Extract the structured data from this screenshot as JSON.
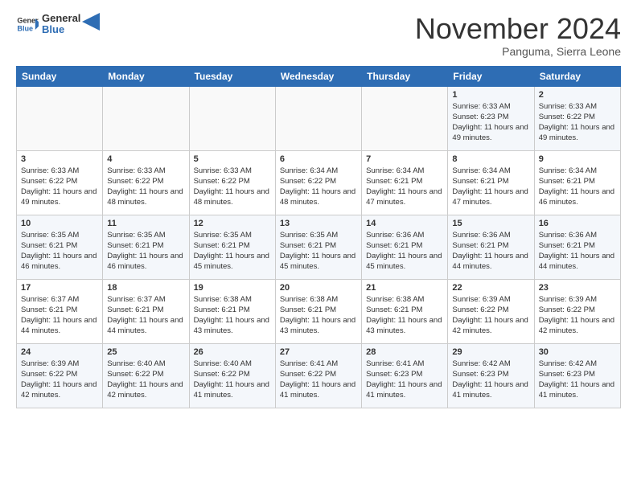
{
  "header": {
    "logo_line1": "General",
    "logo_line2": "Blue",
    "month": "November 2024",
    "location": "Panguma, Sierra Leone"
  },
  "weekdays": [
    "Sunday",
    "Monday",
    "Tuesday",
    "Wednesday",
    "Thursday",
    "Friday",
    "Saturday"
  ],
  "weeks": [
    [
      {
        "day": "",
        "info": ""
      },
      {
        "day": "",
        "info": ""
      },
      {
        "day": "",
        "info": ""
      },
      {
        "day": "",
        "info": ""
      },
      {
        "day": "",
        "info": ""
      },
      {
        "day": "1",
        "info": "Sunrise: 6:33 AM\nSunset: 6:23 PM\nDaylight: 11 hours and 49 minutes."
      },
      {
        "day": "2",
        "info": "Sunrise: 6:33 AM\nSunset: 6:22 PM\nDaylight: 11 hours and 49 minutes."
      }
    ],
    [
      {
        "day": "3",
        "info": "Sunrise: 6:33 AM\nSunset: 6:22 PM\nDaylight: 11 hours and 49 minutes."
      },
      {
        "day": "4",
        "info": "Sunrise: 6:33 AM\nSunset: 6:22 PM\nDaylight: 11 hours and 48 minutes."
      },
      {
        "day": "5",
        "info": "Sunrise: 6:33 AM\nSunset: 6:22 PM\nDaylight: 11 hours and 48 minutes."
      },
      {
        "day": "6",
        "info": "Sunrise: 6:34 AM\nSunset: 6:22 PM\nDaylight: 11 hours and 48 minutes."
      },
      {
        "day": "7",
        "info": "Sunrise: 6:34 AM\nSunset: 6:21 PM\nDaylight: 11 hours and 47 minutes."
      },
      {
        "day": "8",
        "info": "Sunrise: 6:34 AM\nSunset: 6:21 PM\nDaylight: 11 hours and 47 minutes."
      },
      {
        "day": "9",
        "info": "Sunrise: 6:34 AM\nSunset: 6:21 PM\nDaylight: 11 hours and 46 minutes."
      }
    ],
    [
      {
        "day": "10",
        "info": "Sunrise: 6:35 AM\nSunset: 6:21 PM\nDaylight: 11 hours and 46 minutes."
      },
      {
        "day": "11",
        "info": "Sunrise: 6:35 AM\nSunset: 6:21 PM\nDaylight: 11 hours and 46 minutes."
      },
      {
        "day": "12",
        "info": "Sunrise: 6:35 AM\nSunset: 6:21 PM\nDaylight: 11 hours and 45 minutes."
      },
      {
        "day": "13",
        "info": "Sunrise: 6:35 AM\nSunset: 6:21 PM\nDaylight: 11 hours and 45 minutes."
      },
      {
        "day": "14",
        "info": "Sunrise: 6:36 AM\nSunset: 6:21 PM\nDaylight: 11 hours and 45 minutes."
      },
      {
        "day": "15",
        "info": "Sunrise: 6:36 AM\nSunset: 6:21 PM\nDaylight: 11 hours and 44 minutes."
      },
      {
        "day": "16",
        "info": "Sunrise: 6:36 AM\nSunset: 6:21 PM\nDaylight: 11 hours and 44 minutes."
      }
    ],
    [
      {
        "day": "17",
        "info": "Sunrise: 6:37 AM\nSunset: 6:21 PM\nDaylight: 11 hours and 44 minutes."
      },
      {
        "day": "18",
        "info": "Sunrise: 6:37 AM\nSunset: 6:21 PM\nDaylight: 11 hours and 44 minutes."
      },
      {
        "day": "19",
        "info": "Sunrise: 6:38 AM\nSunset: 6:21 PM\nDaylight: 11 hours and 43 minutes."
      },
      {
        "day": "20",
        "info": "Sunrise: 6:38 AM\nSunset: 6:21 PM\nDaylight: 11 hours and 43 minutes."
      },
      {
        "day": "21",
        "info": "Sunrise: 6:38 AM\nSunset: 6:21 PM\nDaylight: 11 hours and 43 minutes."
      },
      {
        "day": "22",
        "info": "Sunrise: 6:39 AM\nSunset: 6:22 PM\nDaylight: 11 hours and 42 minutes."
      },
      {
        "day": "23",
        "info": "Sunrise: 6:39 AM\nSunset: 6:22 PM\nDaylight: 11 hours and 42 minutes."
      }
    ],
    [
      {
        "day": "24",
        "info": "Sunrise: 6:39 AM\nSunset: 6:22 PM\nDaylight: 11 hours and 42 minutes."
      },
      {
        "day": "25",
        "info": "Sunrise: 6:40 AM\nSunset: 6:22 PM\nDaylight: 11 hours and 42 minutes."
      },
      {
        "day": "26",
        "info": "Sunrise: 6:40 AM\nSunset: 6:22 PM\nDaylight: 11 hours and 41 minutes."
      },
      {
        "day": "27",
        "info": "Sunrise: 6:41 AM\nSunset: 6:22 PM\nDaylight: 11 hours and 41 minutes."
      },
      {
        "day": "28",
        "info": "Sunrise: 6:41 AM\nSunset: 6:23 PM\nDaylight: 11 hours and 41 minutes."
      },
      {
        "day": "29",
        "info": "Sunrise: 6:42 AM\nSunset: 6:23 PM\nDaylight: 11 hours and 41 minutes."
      },
      {
        "day": "30",
        "info": "Sunrise: 6:42 AM\nSunset: 6:23 PM\nDaylight: 11 hours and 41 minutes."
      }
    ]
  ]
}
